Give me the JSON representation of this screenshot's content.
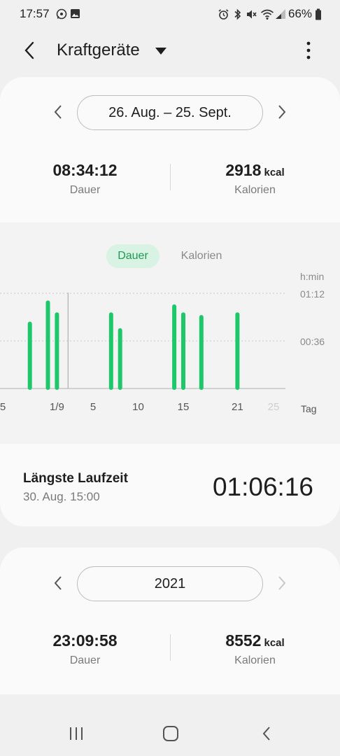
{
  "status_bar": {
    "time": "17:57",
    "battery": "66%",
    "left_icons": [
      "whatsapp-icon",
      "gallery-icon"
    ],
    "right_icons": [
      "alarm-icon",
      "bluetooth-icon",
      "mute-icon",
      "wifi-icon",
      "signal-icon",
      "battery-icon"
    ]
  },
  "header": {
    "title": "Kraftgeräte"
  },
  "period": {
    "range_label": "26. Aug. – 25. Sept.",
    "duration_value": "08:34:12",
    "duration_label": "Dauer",
    "calories_value": "2918",
    "calories_unit": "kcal",
    "calories_label": "Kalorien"
  },
  "chart_toggle": {
    "active": "Dauer",
    "inactive": "Kalorien"
  },
  "chart_data": {
    "type": "bar",
    "unit_label": "h:min",
    "x_axis_label": "Tag",
    "y_ticks": [
      "01:12",
      "00:36"
    ],
    "y_tick_values_min": [
      72,
      36
    ],
    "x_ticks": [
      {
        "label": "5",
        "day": 0,
        "faded": false
      },
      {
        "label": "1/9",
        "day": 6,
        "faded": false
      },
      {
        "label": "5",
        "day": 10,
        "faded": false
      },
      {
        "label": "10",
        "day": 15,
        "faded": false
      },
      {
        "label": "15",
        "day": 20,
        "faded": false
      },
      {
        "label": "21",
        "day": 26,
        "faded": false
      },
      {
        "label": "25",
        "day": 30,
        "faded": true
      }
    ],
    "bars": [
      {
        "day": 3,
        "minutes": 49
      },
      {
        "day": 5,
        "minutes": 65
      },
      {
        "day": 6,
        "minutes": 56
      },
      {
        "day": 12,
        "minutes": 56
      },
      {
        "day": 13,
        "minutes": 44
      },
      {
        "day": 19,
        "minutes": 62
      },
      {
        "day": 20,
        "minutes": 56
      },
      {
        "day": 22,
        "minutes": 54
      },
      {
        "day": 26,
        "minutes": 56
      }
    ],
    "selected_day": 7,
    "ylim": [
      0,
      90
    ],
    "color": "#1ec86a"
  },
  "longest": {
    "title": "Längste Laufzeit",
    "date": "30. Aug. 15:00",
    "value": "01:06:16"
  },
  "year": {
    "label": "2021",
    "duration_value": "23:09:58",
    "duration_label": "Dauer",
    "calories_value": "8552",
    "calories_unit": "kcal",
    "calories_label": "Kalorien"
  }
}
